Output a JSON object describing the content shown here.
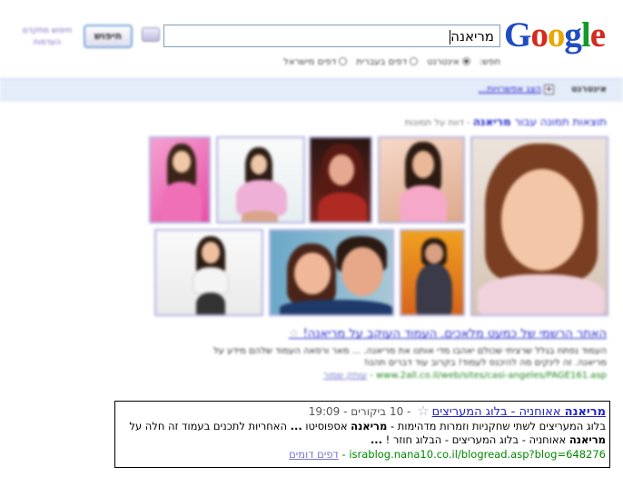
{
  "header": {
    "logo_letters": [
      {
        "ch": "G",
        "color": "#1f4cc1"
      },
      {
        "ch": "o",
        "color": "#d62a1f"
      },
      {
        "ch": "o",
        "color": "#e8a800"
      },
      {
        "ch": "g",
        "color": "#1f4cc1"
      },
      {
        "ch": "l",
        "color": "#119a2a"
      },
      {
        "ch": "e",
        "color": "#d62a1f"
      }
    ],
    "query": "מריאנה",
    "search_button": "חיפוש",
    "adv_link_1": "חיפוש מתקדם",
    "adv_link_2": "העדפות",
    "radio_label": "חפש:",
    "radio_options": [
      "אינטרנט",
      "דפים בעברית",
      "דפים מישראל"
    ]
  },
  "topbar": {
    "scope": "אינטרנט",
    "plus": "+",
    "options": "הצג אפשרויות..."
  },
  "images": {
    "title_prefix": "תוצאות תמונה עבור ",
    "title_query": "מריאנה",
    "sub": " - דווח על תמונות"
  },
  "result1": {
    "title": "האתר הרשמי של כמעט מלאכים. העמוד העוקב על מריאנה!",
    "desc1": "העמוד נפתח בגלל שרציתי שכולם יאהבו מדי אותנו את מריאנה. ... מאר ורסאה העמוד שלהם מידע על",
    "desc2": "מריאנה. זה לינקים מה להיכנס לעמוד! בקרוב עוד דברים תהנו!",
    "url": "www.2all.co.il/web/sites/casi-angeles/PAGE161.asp",
    "cached": "עותק שמור"
  },
  "result2": {
    "title_bold": "מריאנה",
    "title_rest": " אאוחניה - בלוג המעריצים",
    "meta": " - 10 ביקורים - 19:09",
    "desc1_a": "בלוג המעריצים לשתי שחקניות וזמרות מדהימות - ",
    "desc1_b": "מריאנה",
    "desc1_c": " אספוסיטו ",
    "desc1_d": "...",
    "desc1_e": " האחריות לתכנים בעמוד זה חלה על",
    "desc2_a": "מריאנה",
    "desc2_b": " אאוחניה - בלוג המעריצים - הבלוג חוזר ! ",
    "desc2_c": "...",
    "url": "israblog.nana10.co.il/blogread.asp?blog=648276",
    "sep": " - ",
    "similar": "דפים דומים"
  }
}
